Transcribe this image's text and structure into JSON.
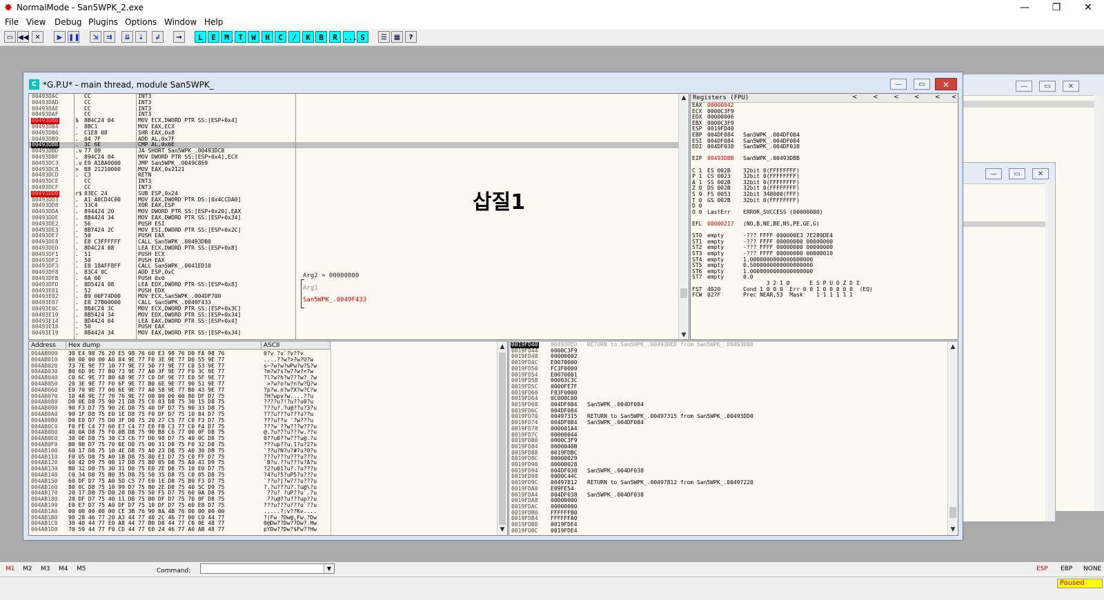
{
  "app": {
    "title": "NormalMode - San5WPK_2.exe",
    "minimize": "—",
    "maximize": "❐",
    "close": "✕"
  },
  "menu": [
    "File",
    "View",
    "Debug",
    "Plugins",
    "Options",
    "Window",
    "Help"
  ],
  "toolbar": {
    "buttons": [
      "open",
      "restart",
      "close",
      "run",
      "pause",
      "step-into",
      "step-over",
      "trace-into",
      "trace-over",
      "execute-till-return",
      "goto"
    ],
    "letters": [
      "L",
      "E",
      "M",
      "T",
      "W",
      "H",
      "C",
      "/",
      "K",
      "B",
      "R",
      "...",
      "S"
    ],
    "extra": [
      "list-icon",
      "grid-icon",
      "?"
    ]
  },
  "cpu": {
    "title": "*G.P.U* - main thread, module San5WPK_",
    "icon_letter": "C",
    "overlay_text": "삽질1",
    "disasm": [
      [
        "00493DAC",
        "",
        "CC",
        "INT3",
        ""
      ],
      [
        "00493DAD",
        "",
        "CC",
        "INT3",
        ""
      ],
      [
        "00493DAE",
        "",
        "CC",
        "INT3",
        ""
      ],
      [
        "00493DAF",
        "",
        "CC",
        "INT3",
        ""
      ],
      [
        "00493DB0",
        "$",
        "8B4C24 04",
        "MOV ECX,DWORD PTR SS:[ESP+0x4]",
        "red"
      ],
      [
        "00493DB4",
        ".",
        "8BC1",
        "MOV EAX,ECX",
        ""
      ],
      [
        "00493DB6",
        ".",
        "C1E8 08",
        "SHR EAX,0x8",
        ""
      ],
      [
        "00493DB9",
        ".",
        "04 7F",
        "ADD AL,0x7F",
        ""
      ],
      [
        "00493DBB",
        ".",
        "3C 6E",
        "CMP AL,0x6E",
        "black"
      ],
      [
        "00493DBD",
        ".v",
        "77 09",
        "JA SHORT San5WPK_.00493DC8",
        ""
      ],
      [
        "00493DBF",
        ".",
        "894C24 04",
        "MOV DWORD PTR SS:[ESP+0x4],ECX",
        ""
      ],
      [
        "00493DC3",
        ".v",
        "E9 A18A0000",
        "JMP San5WPK_.0049C869",
        ""
      ],
      [
        "00493DC8",
        ">",
        "B8 21210000",
        "MOV EAX,0x2121",
        ""
      ],
      [
        "00493DCD",
        ".",
        "C3",
        "RETN",
        ""
      ],
      [
        "00493DCE",
        "",
        "CC",
        "INT3",
        ""
      ],
      [
        "00493DCF",
        "",
        "CC",
        "INT3",
        ""
      ],
      [
        "00493DD0",
        "r$",
        "83EC 24",
        "SUB ESP,0x24",
        "red"
      ],
      [
        "00493DD3",
        ".",
        "A1 A0CD4C00",
        "MOV EAX,DWORD PTR DS:[0x4CCDA0]",
        ""
      ],
      [
        "00493DD8",
        ".",
        "33C4",
        "XOR EAX,ESP",
        ""
      ],
      [
        "00493DDA",
        ".",
        "894424 20",
        "MOV DWORD PTR SS:[ESP+0x20],EAX",
        ""
      ],
      [
        "00493DDE",
        ".",
        "8B4424 34",
        "MOV EAX,DWORD PTR SS:[ESP+0x34]",
        ""
      ],
      [
        "00493DE2",
        ".",
        "56",
        "PUSH ESI",
        ""
      ],
      [
        "00493DE3",
        ".",
        "8B7424 2C",
        "MOV ESI,DWORD PTR SS:[ESP+0x2C]",
        ""
      ],
      [
        "00493DE7",
        ".",
        "50",
        "PUSH EAX",
        ""
      ],
      [
        "00493DE8",
        ".",
        "E8 C3FFFFFF",
        "CALL San5WPK_.00493DB0",
        ""
      ],
      [
        "00493DED",
        ".",
        "8D4C24 08",
        "LEA ECX,DWORD PTR SS:[ESP+0x8]",
        ""
      ],
      [
        "00493DF1",
        ".",
        "51",
        "PUSH ECX",
        ""
      ],
      [
        "00493DF2",
        ".",
        "50",
        "PUSH EAX",
        ""
      ],
      [
        "00493DF3",
        ".",
        "E8 18AFF8FF",
        "CALL San5WPK_.0041ED10",
        ""
      ],
      [
        "00493DF8",
        ".",
        "83C4 0C",
        "ADD ESP,0xC",
        ""
      ],
      [
        "00493DFB",
        ".",
        "6A 00",
        "PUSH 0x0",
        ""
      ],
      [
        "00493DFD",
        ".",
        "8D5424 08",
        "LEA EDX,DWORD PTR SS:[ESP+0x8]",
        ""
      ],
      [
        "00493E01",
        ".",
        "52",
        "PUSH EDX",
        ""
      ],
      [
        "00493E02",
        ".",
        "B9 00F74D00",
        "MOV ECX,San5WPK_.004DF700",
        ""
      ],
      [
        "00493E07",
        ".",
        "E8 27B60000",
        "CALL San5WPK_.0049F433",
        ""
      ],
      [
        "00493E0C",
        ".",
        "8B4C24 3C",
        "MOV ECX,DWORD PTR SS:[ESP+0x3C]",
        ""
      ],
      [
        "00493E10",
        ".",
        "8B5424 34",
        "MOV EDX,DWORD PTR SS:[ESP+0x34]",
        ""
      ],
      [
        "00493E14",
        ".",
        "8D4424 04",
        "LEA EAX,DWORD PTR SS:[ESP+0x4]",
        ""
      ],
      [
        "00493E18",
        ".",
        "50",
        "PUSH EAX",
        ""
      ],
      [
        "00493E19",
        ".",
        "8B4424 34",
        "MOV EAX,DWORD PTR SS:[ESP+0x34]",
        ""
      ]
    ],
    "comments": [
      {
        "row": 30,
        "text": "Arg2 = 00000000",
        "color": "#222"
      },
      {
        "row": 32,
        "text": "Arg1",
        "color": "#888"
      },
      {
        "row": 34,
        "text": "San5WPK_.0049F433",
        "color": "#d40000"
      }
    ],
    "registers": {
      "header": "Registers (FPU)",
      "nav": [
        "<",
        "<",
        "<",
        "<",
        "<",
        "<"
      ],
      "lines": [
        {
          "k": "EAX",
          "v": "00000042",
          "c": "",
          "hl": true
        },
        {
          "k": "ECX",
          "v": "0000C3F9",
          "c": ""
        },
        {
          "k": "EDX",
          "v": "00000006",
          "c": ""
        },
        {
          "k": "EBX",
          "v": "0000C3F9",
          "c": ""
        },
        {
          "k": "ESP",
          "v": "0019FD40",
          "c": ""
        },
        {
          "k": "EBP",
          "v": "004DF084",
          "c": "San5WPK_.004DF084"
        },
        {
          "k": "ESI",
          "v": "004DF084",
          "c": "San5WPK_.004DF084"
        },
        {
          "k": "EDI",
          "v": "004DF038",
          "c": "San5WPK_.004DF038"
        },
        {
          "k": "",
          "v": "",
          "c": ""
        },
        {
          "k": "EIP",
          "v": "00493DBB",
          "c": "San5WPK_.00493DBB",
          "hl": true
        },
        {
          "k": "",
          "v": "",
          "c": ""
        },
        {
          "k": "C 1",
          "v": "ES 002B",
          "c": "32bit 0(FFFFFFFF)"
        },
        {
          "k": "P 1",
          "v": "CS 0023",
          "c": "32bit 0(FFFFFFFF)"
        },
        {
          "k": "A 1",
          "v": "SS 002B",
          "c": "32bit 0(FFFFFFFF)"
        },
        {
          "k": "Z 0",
          "v": "DS 002B",
          "c": "32bit 0(FFFFFFFF)"
        },
        {
          "k": "S 0",
          "v": "FS 0053",
          "c": "32bit 348000(FFF)"
        },
        {
          "k": "T 0",
          "v": "GS 002B",
          "c": "32bit 0(FFFFFFFF)"
        },
        {
          "k": "D 0",
          "v": "",
          "c": ""
        },
        {
          "k": "O 0",
          "v": "LastErr",
          "c": "ERROR_SUCCESS (00000000)"
        },
        {
          "k": "",
          "v": "",
          "c": ""
        },
        {
          "k": "EFL",
          "v": "00000217",
          "c": "(NO,B,NE,BE,NS,PE,GE,G)",
          "hl": true
        },
        {
          "k": "",
          "v": "",
          "c": ""
        },
        {
          "k": "ST0",
          "v": "empty",
          "c": "-??? FFFF 000000E3 7E289DE4"
        },
        {
          "k": "ST1",
          "v": "empty",
          "c": "-??? FFFF 00000000 00000000"
        },
        {
          "k": "ST2",
          "v": "empty",
          "c": "-??? FFFF 00000000 00000000"
        },
        {
          "k": "ST3",
          "v": "empty",
          "c": "-??? FFFF 00000000 00000010"
        },
        {
          "k": "ST4",
          "v": "empty",
          "c": "1.0000000000000000000"
        },
        {
          "k": "ST5",
          "v": "empty",
          "c": "0.5000000000000000000"
        },
        {
          "k": "ST6",
          "v": "empty",
          "c": "1.0000000000000000000"
        },
        {
          "k": "ST7",
          "v": "empty",
          "c": "0.0"
        },
        {
          "k": "",
          "v": "",
          "c": "       3 2 1 0      E S P U O Z D I"
        },
        {
          "k": "FST",
          "v": "4020",
          "c": "Cond 1 0 0 0  Err 0 0 1 0 0 0 0 0  (EQ)"
        },
        {
          "k": "FCW",
          "v": "027F",
          "c": "Prec NEAR,53  Mask    1 1 1 1 1 1"
        }
      ]
    },
    "dump": {
      "headers": [
        "Address",
        "Hex dump",
        "ASCII"
      ],
      "rows": [
        [
          "004AB000",
          "30 E4 98 76 20 E5 98 76 60 E3 98 76 D0 FA 98 76",
          "0?v ?v`?v??v"
        ],
        [
          "004AB010",
          "00 00 00 00 A0 84 9E 77 F0 3E 9E 77 D0 55 9E 77",
          "....??w?>?w?U?w"
        ],
        [
          "004AB020",
          "73 7E 9E 77 10 77 9E 77 50 77 9E 77 C0 53 9E 77",
          "s~?w?w?wPw?w?S?w"
        ],
        [
          "004AB030",
          "B0 6D 9E 77 B0 73 9E 77 A0 3F 9E 77 F0 3C 9E 77",
          "?m?w?s?w??w?<?w"
        ],
        [
          "004AB040",
          "C0 6C 9E 77 B0 68 9E 77 C0 DF 9E 77 E0 5F 9E 77",
          "?l?w?h?w???w?_?w"
        ],
        [
          "004AB050",
          "20 3E 9E 77 F0 6F 9E 77 B0 6E 9E 77 90 51 9E 77",
          " >?w?o?w?n?w?Q?w"
        ],
        [
          "004AB060",
          "E0 70 9E 77 00 6E 9E 77 A0 58 9E 77 B0 43 9E 77",
          "?p?w.n?w?X?w?C?w"
        ],
        [
          "004AB070",
          "10 48 9E 77 70 76 9E 77 00 00 00 00 80 DF D7 75",
          "?H?wpv?w....??u"
        ],
        [
          "004AB080",
          "D0 0E D8 75 90 21 D8 75 C0 03 D8 75 30 15 D8 75",
          "????u?!?u??u0?u"
        ],
        [
          "004AB090",
          "90 F3 D7 75 90 2E D8 75 40 DF D7 75 90 33 D8 75",
          "???u?.?u@??u?3?u"
        ],
        [
          "004AB0A0",
          "90 1F D8 75 E0 1E D8 75 F0 DF D7 75 10 84 D7 75",
          "???u???u???u??u"
        ],
        [
          "004AB0B0",
          "D0 E0 D7 75 D0 3F D8 75 20 27 C5 77 C0 F3 D7 75",
          "???u??u '?w???u"
        ],
        [
          "004AB0C0",
          "F0 FE C4 77 60 E7 C4 77 E0 FB C3 77 C0 F4 D7 75",
          "???w`??w???w???u"
        ],
        [
          "004AB0D0",
          "40 0A D8 75 F0 0B D8 75 90 B8 C6 77 00 0F D8 75",
          "@.?u???u???w.??u"
        ],
        [
          "004AB0E0",
          "30 0E D8 75 30 C3 C6 77 D0 98 D7 75 40 0C D8 75",
          "0??u0??w???u@.?u"
        ],
        [
          "004AB0F0",
          "B0 98 D7 75 70 0E D8 75 00 31 D8 75 F0 32 D8 75",
          "???up??u.1?u?2?u"
        ],
        [
          "004AB100",
          "60 17 D8 75 10 4E D8 75 A0 23 D8 75 A0 30 D8 75",
          "`??u?N?u?#?u?0?u"
        ],
        [
          "004AB110",
          "F0 05 D8 75 A0 1B D8 75 80 E1 D7 75 C0 FF D7 75",
          "???u???u???u???u"
        ],
        [
          "004AB120",
          "60 42 D9 75 00 17 D8 75 B0 05 D8 75 A0 41 D9 75",
          "`B?u.??u???u?A?u"
        ],
        [
          "004AB130",
          "B0 32 D8 75 30 31 D8 75 E0 2E D8 75 10 E0 D7 75",
          "?2?u01?u?.?u???u"
        ],
        [
          "004AB140",
          "C0 34 D8 75 B0 35 D8 75 50 35 D8 75 C0 05 D8 75",
          "?4?u?5?uP5?u???u"
        ],
        [
          "004AB150",
          "60 DF D7 75 A0 5D C5 77 E0 1E D8 75 80 F3 D7 75",
          "`??u?]?w???u???u"
        ],
        [
          "004AB160",
          "80 0C D8 75 10 99 D7 75 80 2E D8 75 40 5C D9 75",
          "?.?u???u?.?u@\\?u"
        ],
        [
          "004AB170",
          "20 17 D8 75 D0 20 D8 75 50 F5 D7 75 60 0A D8 75",
          " ??u? ?uP??u`.?u"
        ],
        [
          "004AB180",
          "20 DF D7 75 40 11 D8 75 B0 DF D7 75 70 0F D8 75",
          " ??u@??u???up??u"
        ],
        [
          "004AB190",
          "E0 E7 D7 75 A0 DF D7 75 10 DF D7 75 60 E8 D7 75",
          "???u???u???u`??u"
        ],
        [
          "004AB1A0",
          "00 00 00 00 00 CE 3B 76 90 8A 4B 76 00 00 00 00",
          ".....?;v??Kv...."
        ],
        [
          "004AB1B0",
          "90 28 46 77 20 A3 44 77 40 2C 46 77 00 C0 44 77",
          "?(Fw ?Dw@,Fw.?Dw"
        ],
        [
          "004AB1C0",
          "30 40 44 77 E0 A8 44 77 B0 D8 44 77 C0 0E 48 77",
          "0@Dw??Dw??Dw?.Hw"
        ],
        [
          "004AB1D0",
          "70 59 44 77 F0 CD 44 77 E0 24 46 77 A0 AB 48 77",
          "pYDw??Dw?$Fw??Hw"
        ]
      ]
    },
    "stack": [
      [
        "0019FD40",
        "00493DED",
        "RETURN to San5WPK_.00493DED from San5WPK_.00493DB0",
        true
      ],
      [
        "0019FD44",
        "0000C3F9",
        "",
        false
      ],
      [
        "0019FD48",
        "00000002",
        "",
        false
      ],
      [
        "0019FD4C",
        "E0070000",
        "",
        false
      ],
      [
        "0019FD50",
        "FC3F0000",
        "",
        false
      ],
      [
        "0019FD54",
        "E0070001",
        "",
        false
      ],
      [
        "0019FD58",
        "00003C3C",
        "",
        false
      ],
      [
        "0019FD5C",
        "0000FE7F",
        "",
        false
      ],
      [
        "0019FD60",
        "F83F0000",
        "",
        false
      ],
      [
        "0019FD64",
        "0C000C00",
        "",
        false
      ],
      [
        "0019FD68",
        "004DF084",
        "San5WPK_.004DF084",
        false
      ],
      [
        "0019FD6C",
        "004DF084",
        "",
        false
      ],
      [
        "0019FD70",
        "00497315",
        "RETURN to San5WPK_.00497315 from San5WPK_.00493DD0",
        false
      ],
      [
        "0019FD74",
        "004DF084",
        "San5WPK_.004DF084",
        false
      ],
      [
        "0019FD78",
        "000001A4",
        "",
        false
      ],
      [
        "0019FD7C",
        "00000044",
        "",
        false
      ],
      [
        "0019FD80",
        "0000C3F9",
        "",
        false
      ],
      [
        "0019FD84",
        "0000040B",
        "",
        false
      ],
      [
        "0019FD88",
        "0019FDBC",
        "",
        false
      ],
      [
        "0019FD8C",
        "00000029",
        "",
        false
      ],
      [
        "0019FD90",
        "00000028",
        "",
        false
      ],
      [
        "0019FD94",
        "004DF038",
        "San5WPK_.004DF038",
        false
      ],
      [
        "0019FD98",
        "0000C44C",
        "",
        false
      ],
      [
        "0019FD9C",
        "00497812",
        "RETURN to San5WPK_.00497812 from San5WPK_.00497220",
        false
      ],
      [
        "0019FDA0",
        "E09FE54",
        "",
        false
      ],
      [
        "0019FDA4",
        "004DF038",
        "San5WPK_.004DF038",
        false
      ],
      [
        "0019FDA8",
        "00000000",
        "",
        false
      ],
      [
        "0019FDAC",
        "00000000",
        "",
        false
      ],
      [
        "0019FDB0",
        "FFFFFFB0",
        "",
        false
      ],
      [
        "0019FDB4",
        "FFFFFFA0",
        "",
        false
      ],
      [
        "0019FDB8",
        "0019FDE4",
        "",
        false
      ],
      [
        "0019FDBC",
        "0019FDE4",
        "",
        false
      ]
    ]
  },
  "bottom": {
    "markers": [
      "M1",
      "M2",
      "M3",
      "M4",
      "M5"
    ],
    "command_label": "Command:",
    "regs": [
      "ESP",
      "EBP",
      "NONE"
    ],
    "status": "Paused"
  }
}
